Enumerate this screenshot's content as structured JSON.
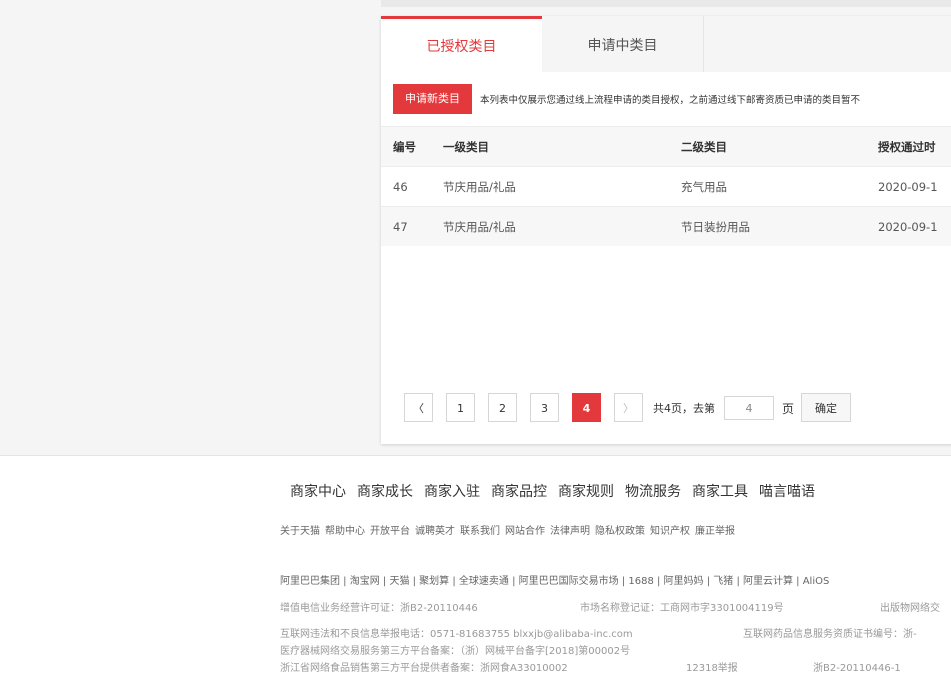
{
  "tabs": {
    "authorized": "已授权类目",
    "applying": "申请中类目"
  },
  "toolbar": {
    "apply_button": "申请新类目",
    "notice": "本列表中仅展示您通过线上流程申请的类目授权，之前通过线下邮寄资质已申请的类目暂不"
  },
  "table": {
    "headers": [
      "编号",
      "一级类目",
      "二级类目",
      "授权通过时"
    ],
    "rows": [
      {
        "id": "46",
        "category1": "节庆用品/礼品",
        "category2": "充气用品",
        "date": "2020-09-1"
      },
      {
        "id": "47",
        "category1": "节庆用品/礼品",
        "category2": "节日装扮用品",
        "date": "2020-09-1"
      }
    ]
  },
  "pagination": {
    "prev": "〈",
    "pages": [
      "1",
      "2",
      "3",
      "4"
    ],
    "current_page": "4",
    "next": "〉",
    "total_text": "共4页，去第",
    "jump_value": "4",
    "unit": "页",
    "confirm": "确定"
  },
  "footer": {
    "nav": [
      "商家中心",
      "商家成长",
      "商家入驻",
      "商家品控",
      "商家规则",
      "物流服务",
      "商家工具",
      "喵言喵语"
    ],
    "links": [
      "关于天猫",
      "帮助中心",
      "开放平台",
      "诚聘英才",
      "联系我们",
      "网站合作",
      "法律声明",
      "隐私权政策",
      "知识产权",
      "廉正举报"
    ],
    "group_line": "阿里巴巴集团 | 淘宝网 | 天猫 | 聚划算 | 全球速卖通 | 阿里巴巴国际交易市场 | 1688 | 阿里妈妈 | 飞猪 | 阿里云计算 | AliOS",
    "license1": "增值电信业务经营许可证：浙B2-20110446",
    "market_reg": "市场名称登记证：工商网市字3301004119号",
    "publish": "出版物网络交",
    "report_phone": "互联网违法和不良信息举报电话：0571-81683755 blxxjb@alibaba-inc.com",
    "drug_cert": "互联网药品信息服务资质证书编号：浙-",
    "medical": "医疗器械网络交易服务第三方平台备案：（浙）网械平台备字[2018]第00002号",
    "food": "浙江省网络食品销售第三方平台提供者备案：浙网食A33010002",
    "hotline": "12318举报",
    "icp": "浙B2-20110446-1"
  }
}
